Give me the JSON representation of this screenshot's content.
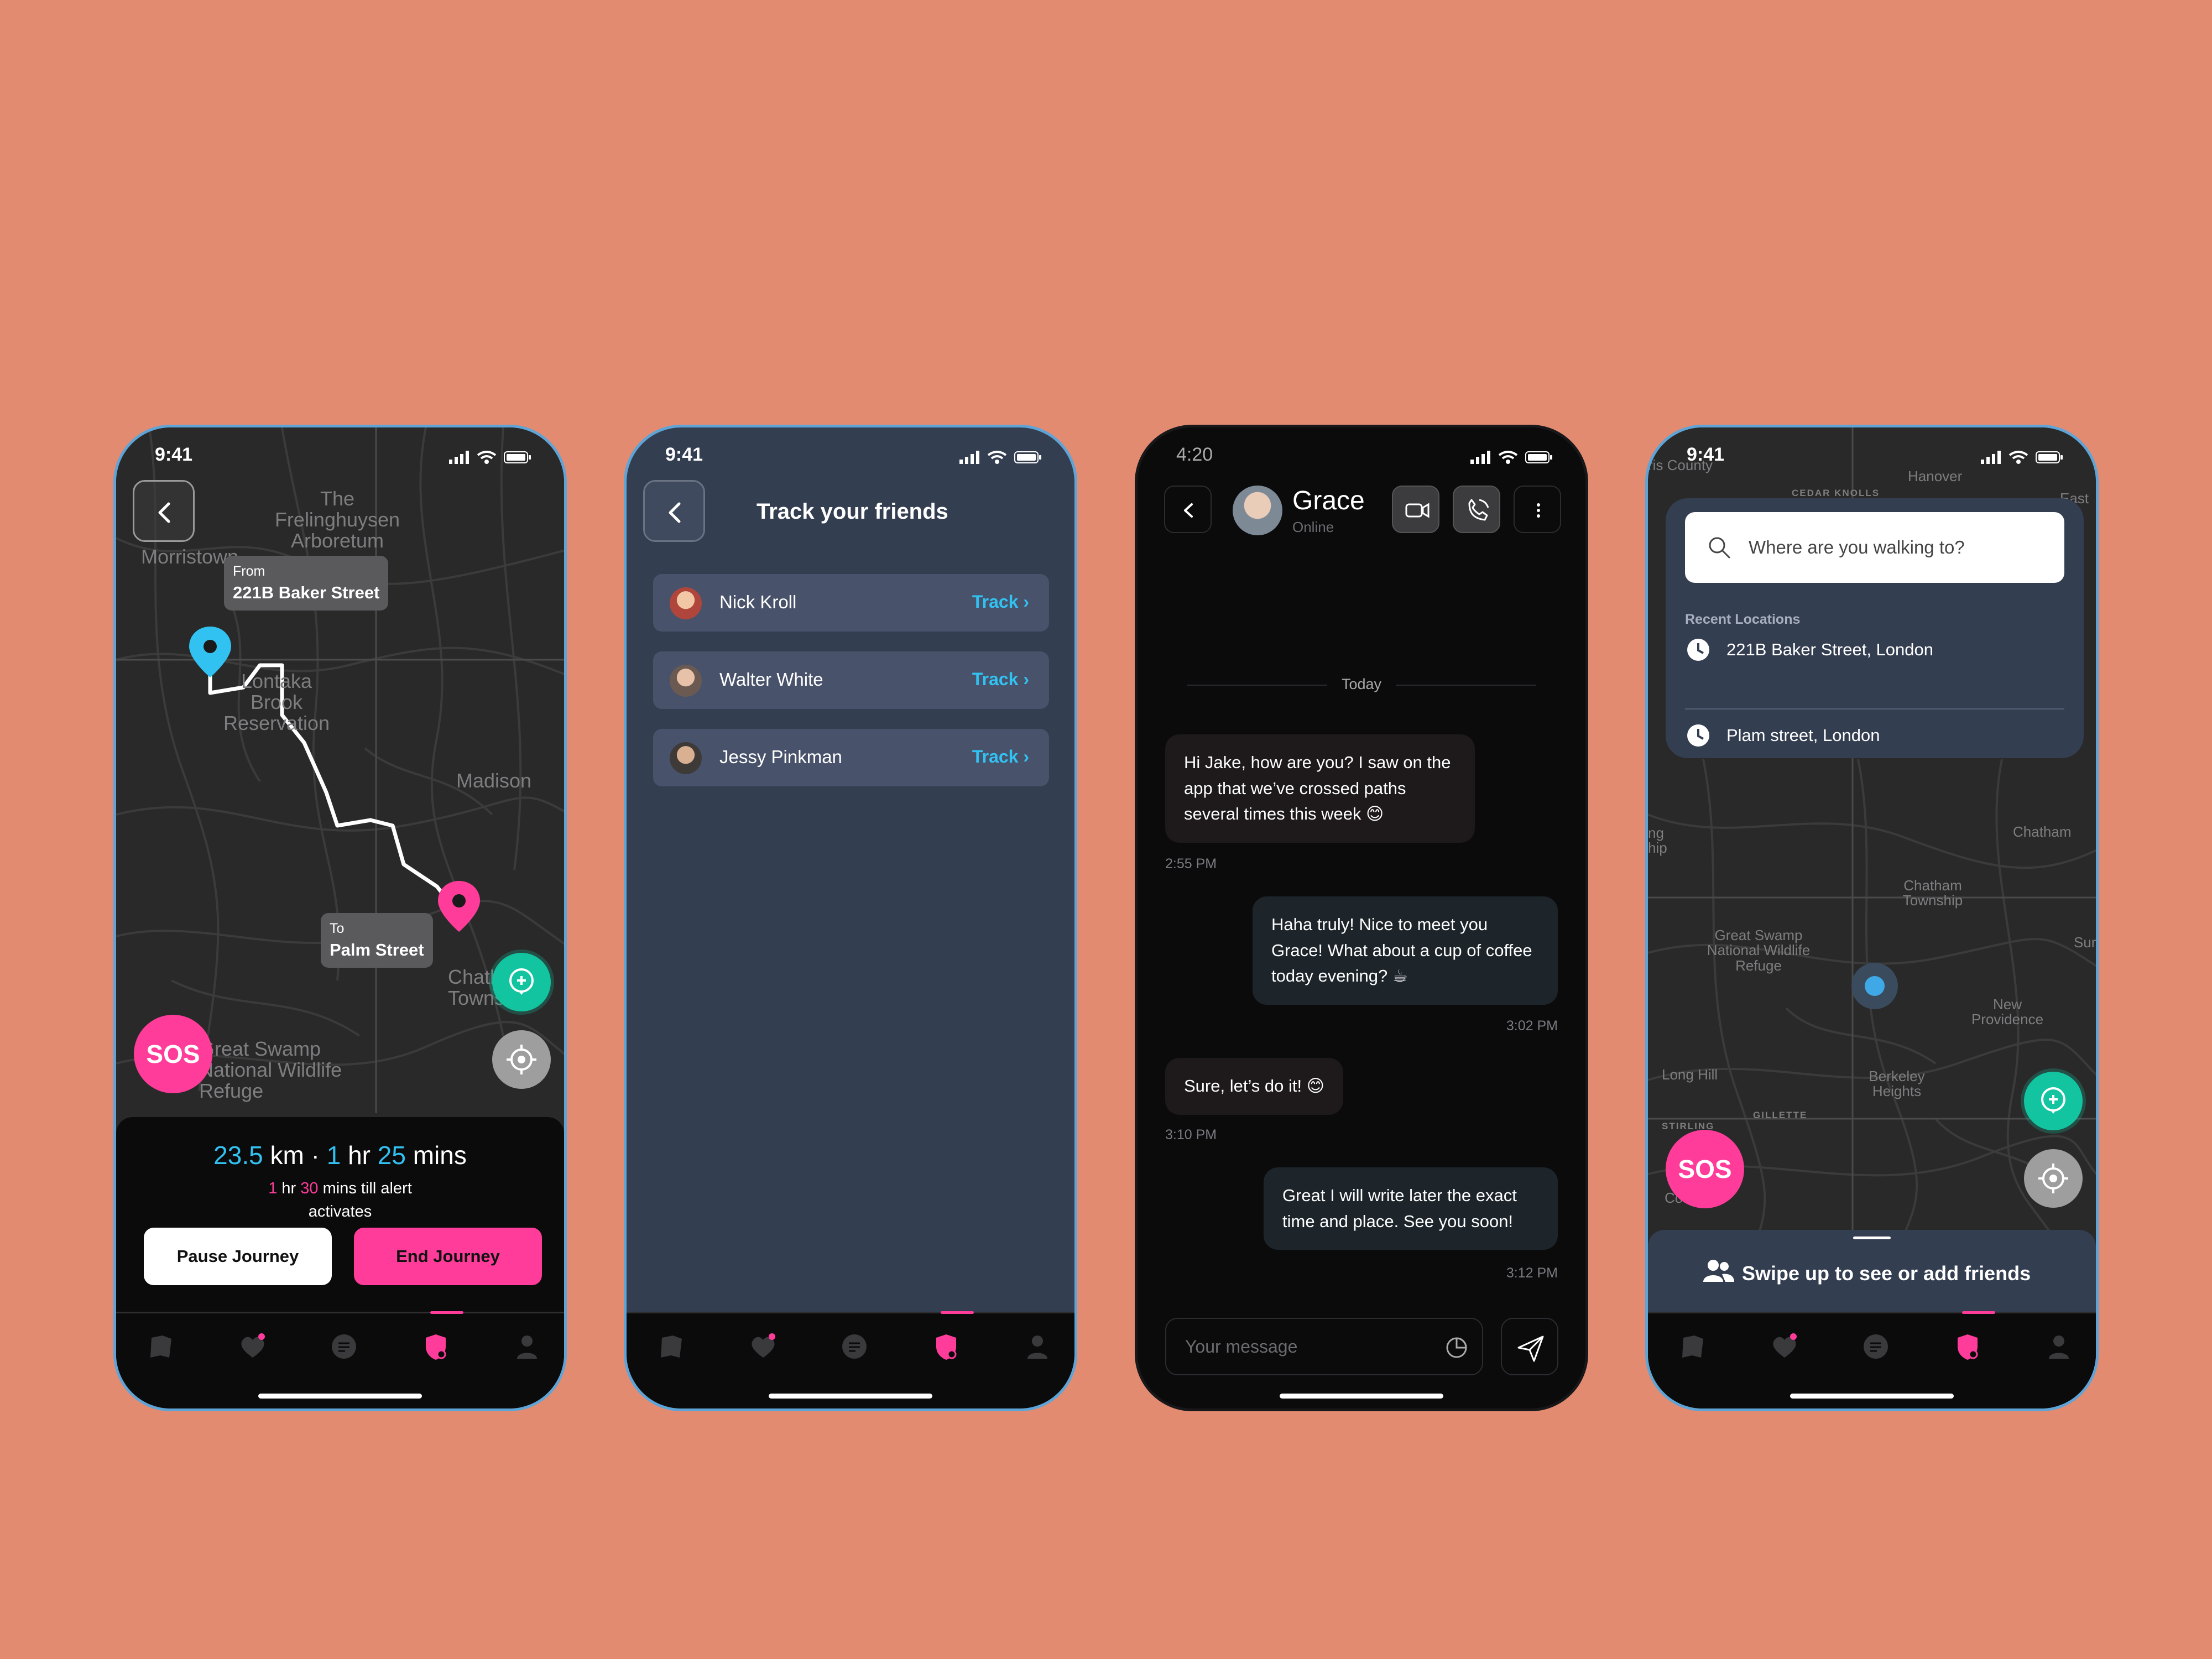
{
  "status": {
    "time_a": "9:41",
    "time_b": "4:20"
  },
  "screen1": {
    "map_labels": [
      "The Frelinghuysen Arboretum",
      "Morristown",
      "Lontaka Brook Reservation",
      "Madison",
      "Chatham Township",
      "Great Swamp National Wildlife Refuge"
    ],
    "from_label": "From",
    "from_value": "221B Baker Street",
    "to_label": "To",
    "to_value": "Palm Street",
    "sos": "SOS",
    "dist_num": "23.5",
    "dist_unit": "km",
    "dot": "·",
    "hr_num": "1",
    "hr_unit": "hr",
    "min_num": "25",
    "min_unit": "mins",
    "alert_h": "1",
    "alert_hr": "hr",
    "alert_m": "30",
    "alert_rest": "mins till alert activates",
    "pause": "Pause Journey",
    "end": "End Journey"
  },
  "screen2": {
    "title": "Track your friends",
    "friends": [
      {
        "name": "Nick Kroll",
        "action": "Track ›"
      },
      {
        "name": "Walter White",
        "action": "Track ›"
      },
      {
        "name": "Jessy Pinkman",
        "action": "Track ›"
      }
    ]
  },
  "screen3": {
    "name": "Grace",
    "status": "Online",
    "day": "Today",
    "messages": [
      {
        "text": "Hi Jake, how are you? I saw on the app that we’ve crossed paths several times this week 😊",
        "time": "2:55 PM",
        "dir": "in"
      },
      {
        "text": "Haha truly! Nice to meet you Grace! What about a cup of coffee today evening? ☕",
        "time": "3:02 PM",
        "dir": "out"
      },
      {
        "text": "Sure, let’s do it! 😊",
        "time": "3:10 PM",
        "dir": "in"
      },
      {
        "text": "Great I will write later the exact time and place. See you soon!",
        "time": "3:12 PM",
        "dir": "out"
      }
    ],
    "placeholder": "Your message"
  },
  "screen4": {
    "search_placeholder": "Where are you walking to?",
    "recent_heading": "Recent Locations",
    "recent": [
      "221B Baker Street, London",
      "Plam street, London"
    ],
    "map_labels": [
      "Hanover",
      "CEDAR KNOLLS",
      "East H",
      "Chatham",
      "Chatham Township",
      "Great Swamp National Wildlife Refuge",
      "New Providence",
      "Long Hill",
      "Berkeley Heights",
      "GILLETTE",
      "STIRLING",
      "Sur",
      "ng hip",
      "ris County",
      "Count"
    ],
    "sos": "SOS",
    "swipe": "Swipe up to see or add friends"
  },
  "colors": {
    "background": "#E38B71",
    "accent_pink": "#FF3C9A",
    "accent_cyan": "#32C2F2",
    "accent_green": "#13C4A1",
    "panel": "#343E51"
  },
  "icons": [
    "back-arrow-icon",
    "signal-icon",
    "wifi-icon",
    "battery-icon",
    "location-pin-icon",
    "add-pin-icon",
    "recenter-icon",
    "map-tab-icon",
    "heart-tab-icon",
    "chat-tab-icon",
    "shield-tab-icon",
    "profile-tab-icon",
    "video-call-icon",
    "phone-call-icon",
    "more-icon",
    "sticker-icon",
    "send-icon",
    "search-icon",
    "clock-icon",
    "friends-icon"
  ]
}
